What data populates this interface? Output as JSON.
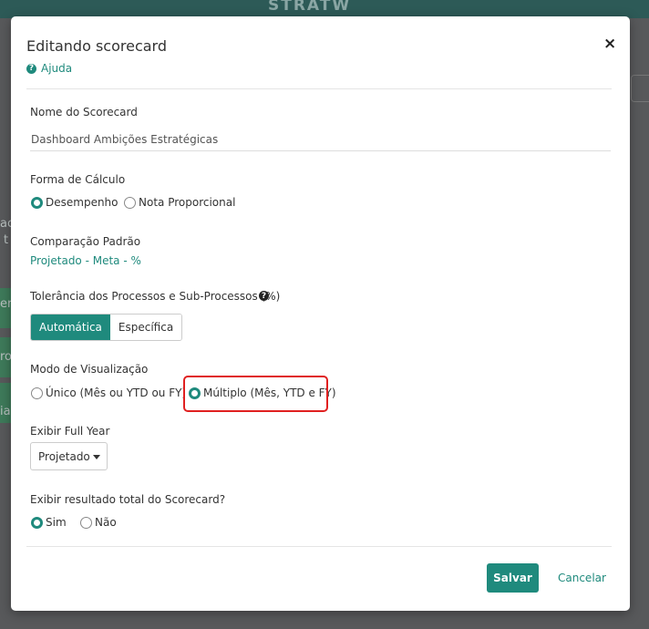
{
  "background": {
    "logo": "STRATW",
    "fragments": [
      "er",
      "ac",
      "t",
      "ro",
      "ia"
    ]
  },
  "modal": {
    "title": "Editando scorecard",
    "close_icon": "×",
    "help_label": "Ajuda",
    "help_icon": "?",
    "name_label": "Nome do Scorecard",
    "name_value": "Dashboard Ambições Estratégicas",
    "calc_label": "Forma de Cálculo",
    "calc_options": [
      {
        "label": "Desempenho",
        "checked": true
      },
      {
        "label": "Nota Proporcional",
        "checked": false
      }
    ],
    "comparison_label": "Comparação Padrão",
    "comparison_value": "Projetado - Meta - %",
    "tolerance_label": "Tolerância dos Processos e Sub-Processos (%)",
    "tolerance_help_icon": "?",
    "tolerance_options": [
      {
        "label": "Automática",
        "active": true
      },
      {
        "label": "Específica",
        "active": false
      }
    ],
    "view_mode_label": "Modo de Visualização",
    "view_mode_options": [
      {
        "label": "Único (Mês ou YTD ou FY)",
        "checked": false
      },
      {
        "label": "Múltiplo (Mês, YTD e FY)",
        "checked": true
      }
    ],
    "full_year_label": "Exibir Full Year",
    "full_year_selected": "Projetado",
    "total_label": "Exibir resultado total do Scorecard?",
    "total_options": [
      {
        "label": "Sim",
        "checked": true
      },
      {
        "label": "Não",
        "checked": false
      }
    ],
    "save_label": "Salvar",
    "cancel_label": "Cancelar"
  },
  "colors": {
    "accent": "#1f8a7d",
    "highlight": "#e02020"
  }
}
